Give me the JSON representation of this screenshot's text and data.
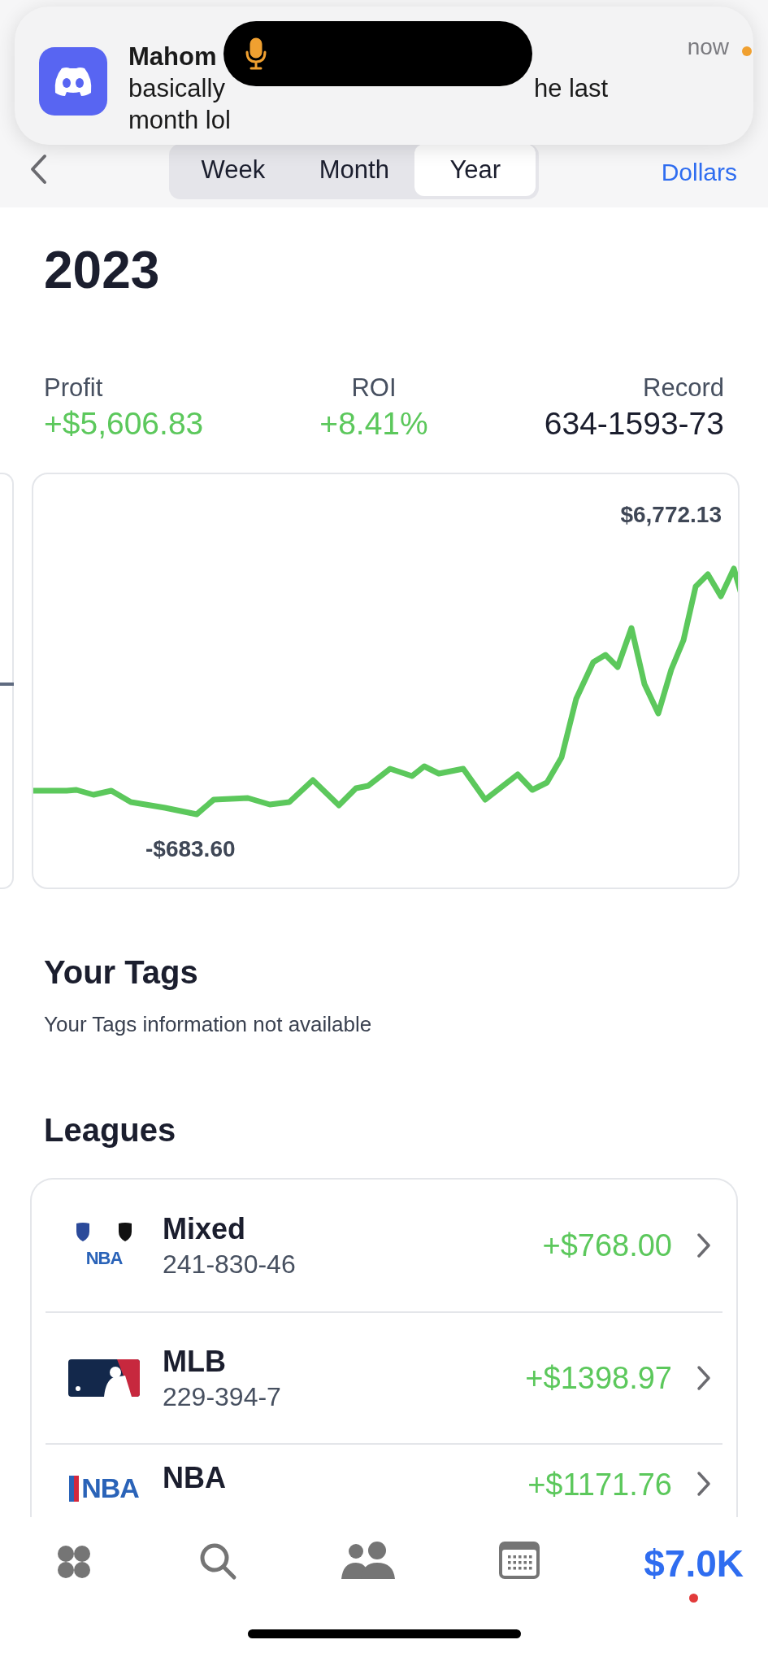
{
  "notification": {
    "title": "Mahom",
    "body_start": "basically",
    "body_end": "he last",
    "body_line_2": "month lol",
    "time": "now"
  },
  "nav": {
    "segments": [
      {
        "label": "Week",
        "selected": false
      },
      {
        "label": "Month",
        "selected": false
      },
      {
        "label": "Year",
        "selected": true
      }
    ],
    "unit": "Dollars"
  },
  "year": "2023",
  "stats": [
    {
      "label": "Profit",
      "value": "+$5,606.83",
      "positive": true
    },
    {
      "label": "ROI",
      "value": "+8.41%",
      "positive": true
    },
    {
      "label": "Record",
      "value": "634-1593-73",
      "positive": false
    }
  ],
  "chart": {
    "max_label": "$6,772.13",
    "min_label": "-$683.60"
  },
  "tags": {
    "title": "Your Tags",
    "message": "Your Tags information not available"
  },
  "leagues": {
    "title": "Leagues",
    "items": [
      {
        "kind": "mixed",
        "logo_text": "NBA",
        "name": "Mixed",
        "record": "241-830-46",
        "amount": "+$768.00"
      },
      {
        "kind": "mlb",
        "name": "MLB",
        "record": "229-394-7",
        "amount": "+$1398.97"
      },
      {
        "kind": "nba",
        "logo_text": "NBA",
        "name": "NBA",
        "amount": "+$1171.76"
      }
    ]
  },
  "tab_bar": {
    "items": [
      {
        "kind": "clover",
        "selected": false
      },
      {
        "kind": "search",
        "selected": false
      },
      {
        "kind": "people",
        "selected": false
      },
      {
        "kind": "calendar",
        "selected": false
      },
      {
        "kind": "balance",
        "label": "$7.0K",
        "selected": true,
        "alert": true
      }
    ]
  }
}
